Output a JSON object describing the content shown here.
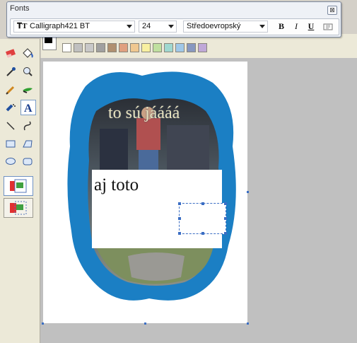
{
  "fonts_dialog": {
    "title": "Fonts",
    "close_glyph": "⊠",
    "font_name": "Calligraph421 BT",
    "font_size": "24",
    "script": "Středoevropský",
    "bold_label": "B",
    "italic_label": "I",
    "underline_label": "U",
    "font_icon": "truetype-font-icon",
    "vertical_text_icon": "vertical-text-icon"
  },
  "palette": {
    "foreground": "#000000",
    "background": "#ffffff",
    "colors": [
      "#ffffff",
      "#c0c0c0",
      "#c8c8c8",
      "#a0a0a0",
      "#b09070",
      "#e0a080",
      "#f0c890",
      "#f8f0a0",
      "#c0e0a0",
      "#a0d8d0",
      "#a0c8e8",
      "#8898c0",
      "#c0a8d8"
    ]
  },
  "tools": [
    "eraser-icon",
    "fill-bucket-icon",
    "color-picker-icon",
    "magnifier-icon",
    "pencil-icon",
    "brush-icon",
    "airbrush-icon",
    "text-tool-icon",
    "line-icon",
    "curve-icon",
    "rectangle-icon",
    "polygon-icon",
    "ellipse-icon",
    "rounded-rectangle-icon"
  ],
  "tool_options": [
    "opaque-background-icon",
    "transparent-background-icon"
  ],
  "canvas_text": {
    "top_caption": "to sú jáááá",
    "box_text": "aj toto"
  }
}
